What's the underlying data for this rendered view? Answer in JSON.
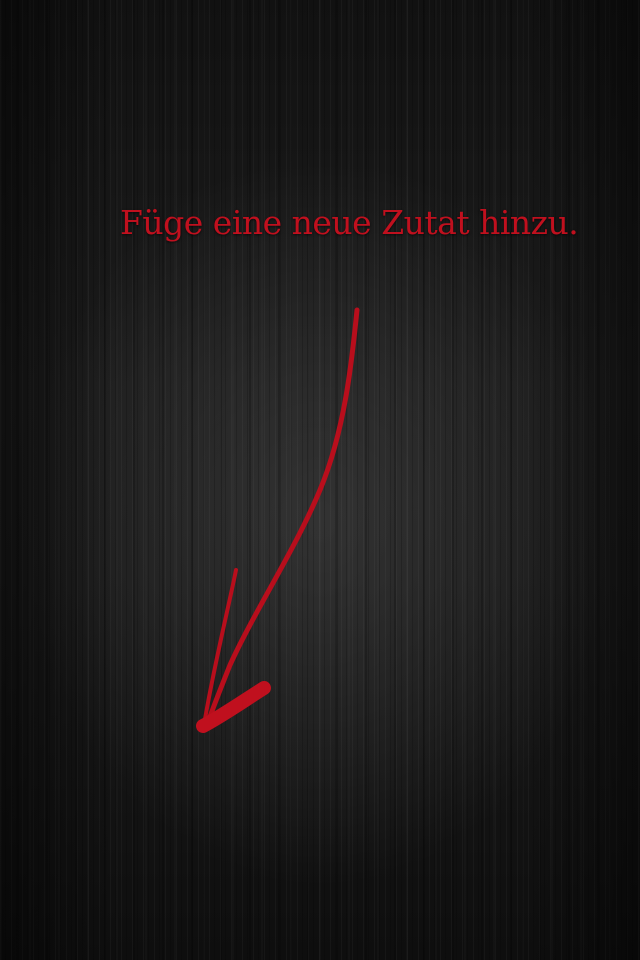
{
  "hint": {
    "text": "Füge eine neue Zutat hinzu."
  },
  "colors": {
    "accent": "#c0101e",
    "background": "#1a1a1a"
  },
  "icons": {
    "arrow": "hand-drawn-arrow-down-left"
  }
}
